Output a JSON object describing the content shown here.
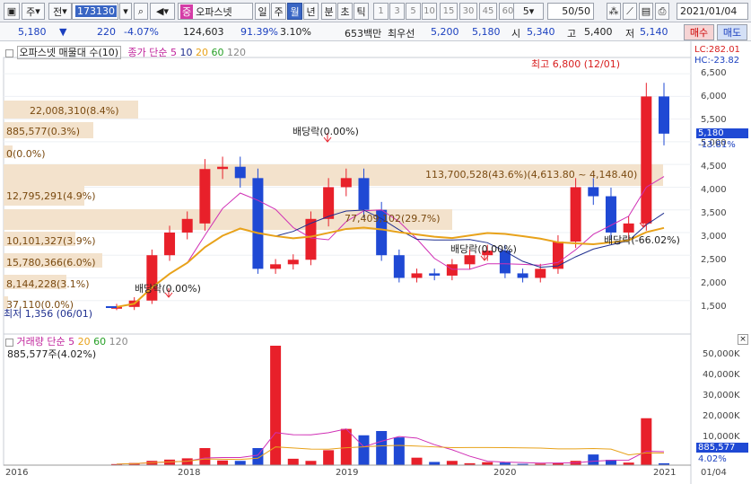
{
  "toolbar": {
    "type": "주",
    "market": "전",
    "code": "173130",
    "stock_badge": "중",
    "stock_name": "오파스넷",
    "periods": [
      "일",
      "주",
      "월",
      "년",
      "분",
      "초",
      "틱"
    ],
    "active_period": "월",
    "intervals": [
      "1",
      "3",
      "5",
      "10",
      "15",
      "30",
      "45",
      "60"
    ],
    "interval_value": "5",
    "count": "50/50",
    "date": "2021/01/04"
  },
  "quote": {
    "price": "5,180",
    "change": "220",
    "change_pct": "-4.07%",
    "volume": "124,603",
    "vol_ratio": "91.39%",
    "turnover": "3.10%",
    "amount": "653백만",
    "best_label": "최우선",
    "ask": "5,200",
    "bid": "5,180",
    "open_label": "시",
    "open": "5,340",
    "high_label": "고",
    "high": "5,400",
    "low_label": "저",
    "low": "5,140",
    "buy": "매수",
    "sell": "매도"
  },
  "price_panel": {
    "legend_title": "오파스넷 매물대 수(10)",
    "ma_label": "종가 단순",
    "ma_periods": [
      "5",
      "10",
      "20",
      "60",
      "120"
    ],
    "lc": "LC:282.01",
    "hc": "HC:-23.82",
    "high_note": "최고 6,800 (12/01)",
    "low_note": "최저 1,356 (06/01)",
    "dividend_notes": [
      "배당락(0.00%)",
      "배당락(0.00%)",
      "배당락(0.00%)",
      "배당락(-66.02%)"
    ],
    "current_price_tag": "5,180",
    "current_pct_tag": "-13.81%",
    "y_ticks": [
      "6,500",
      "6,000",
      "5,500",
      "5,000",
      "4,500",
      "4,000",
      "3,500",
      "3,000",
      "2,500",
      "2,000",
      "1,500"
    ],
    "volume_profile": [
      "22,008,310(8.4%)",
      "885,577(0.3%)",
      "0(0.0%)",
      "113,700,528(43.6%)(4,613.80 ~ 4,148.40)",
      "12,795,291(4.9%)",
      "77,409,102(29.7%)",
      "10,101,327(3.9%)",
      "15,780,366(6.0%)",
      "8,144,228(3.1%)",
      "37,110(0.0%)"
    ]
  },
  "volume_panel": {
    "legend_title": "거래량",
    "ma_label": "단순",
    "ma_periods": [
      "5",
      "20",
      "60",
      "120"
    ],
    "current_note": "885,577주(4.02%)",
    "y_ticks": [
      "50,000K",
      "40,000K",
      "30,000K",
      "20,000K",
      "10,000K"
    ],
    "current_tag": "885,577",
    "current_pct_tag": "4.02%"
  },
  "x_axis": {
    "labels": [
      "2016",
      "2018",
      "2019",
      "2020",
      "2021",
      "01/04"
    ]
  },
  "colors": {
    "up": "#e8202a",
    "down": "#1f49d4",
    "ma5": "#d02fb5",
    "ma10": "#1f2f8f",
    "ma20": "#e8a21a",
    "profile": "#f3e2cc"
  },
  "chart_data": {
    "type": "candlestick",
    "x": [
      "2018-06",
      "2018-07",
      "2018-08",
      "2018-09",
      "2018-10",
      "2018-11",
      "2018-12",
      "2019-01",
      "2019-02",
      "2019-03",
      "2019-04",
      "2019-05",
      "2019-06",
      "2019-07",
      "2019-08",
      "2019-09",
      "2019-10",
      "2019-11",
      "2019-12",
      "2020-01",
      "2020-02",
      "2020-03",
      "2020-04",
      "2020-05",
      "2020-06",
      "2020-07",
      "2020-08",
      "2020-09",
      "2020-10",
      "2020-11",
      "2020-12",
      "2021-01"
    ],
    "open": [
      1356,
      1360,
      1500,
      2500,
      3000,
      3200,
      4400,
      4450,
      4200,
      2200,
      2300,
      2400,
      3300,
      4000,
      4200,
      3500,
      2500,
      2000,
      2100,
      2050,
      2300,
      2500,
      2600,
      2100,
      2000,
      2200,
      2800,
      4000,
      3800,
      3000,
      3200,
      6000
    ],
    "close": [
      1360,
      1500,
      2500,
      3000,
      3300,
      4400,
      4450,
      4200,
      2200,
      2300,
      2400,
      3300,
      4000,
      4200,
      3500,
      2500,
      2000,
      2100,
      2050,
      2300,
      2500,
      2600,
      2100,
      2000,
      2200,
      2800,
      4000,
      3800,
      3000,
      3200,
      6000,
      5180
    ],
    "volume": [
      500,
      1000,
      2000,
      2600,
      3200,
      8000,
      2200,
      2000,
      8000,
      56000,
      3000,
      2000,
      7000,
      17000,
      14000,
      16000,
      13000,
      3500,
      1500,
      2000,
      900,
      1400,
      1200,
      600,
      700,
      1000,
      2000,
      5000,
      2500,
      1200,
      22000,
      885
    ]
  }
}
